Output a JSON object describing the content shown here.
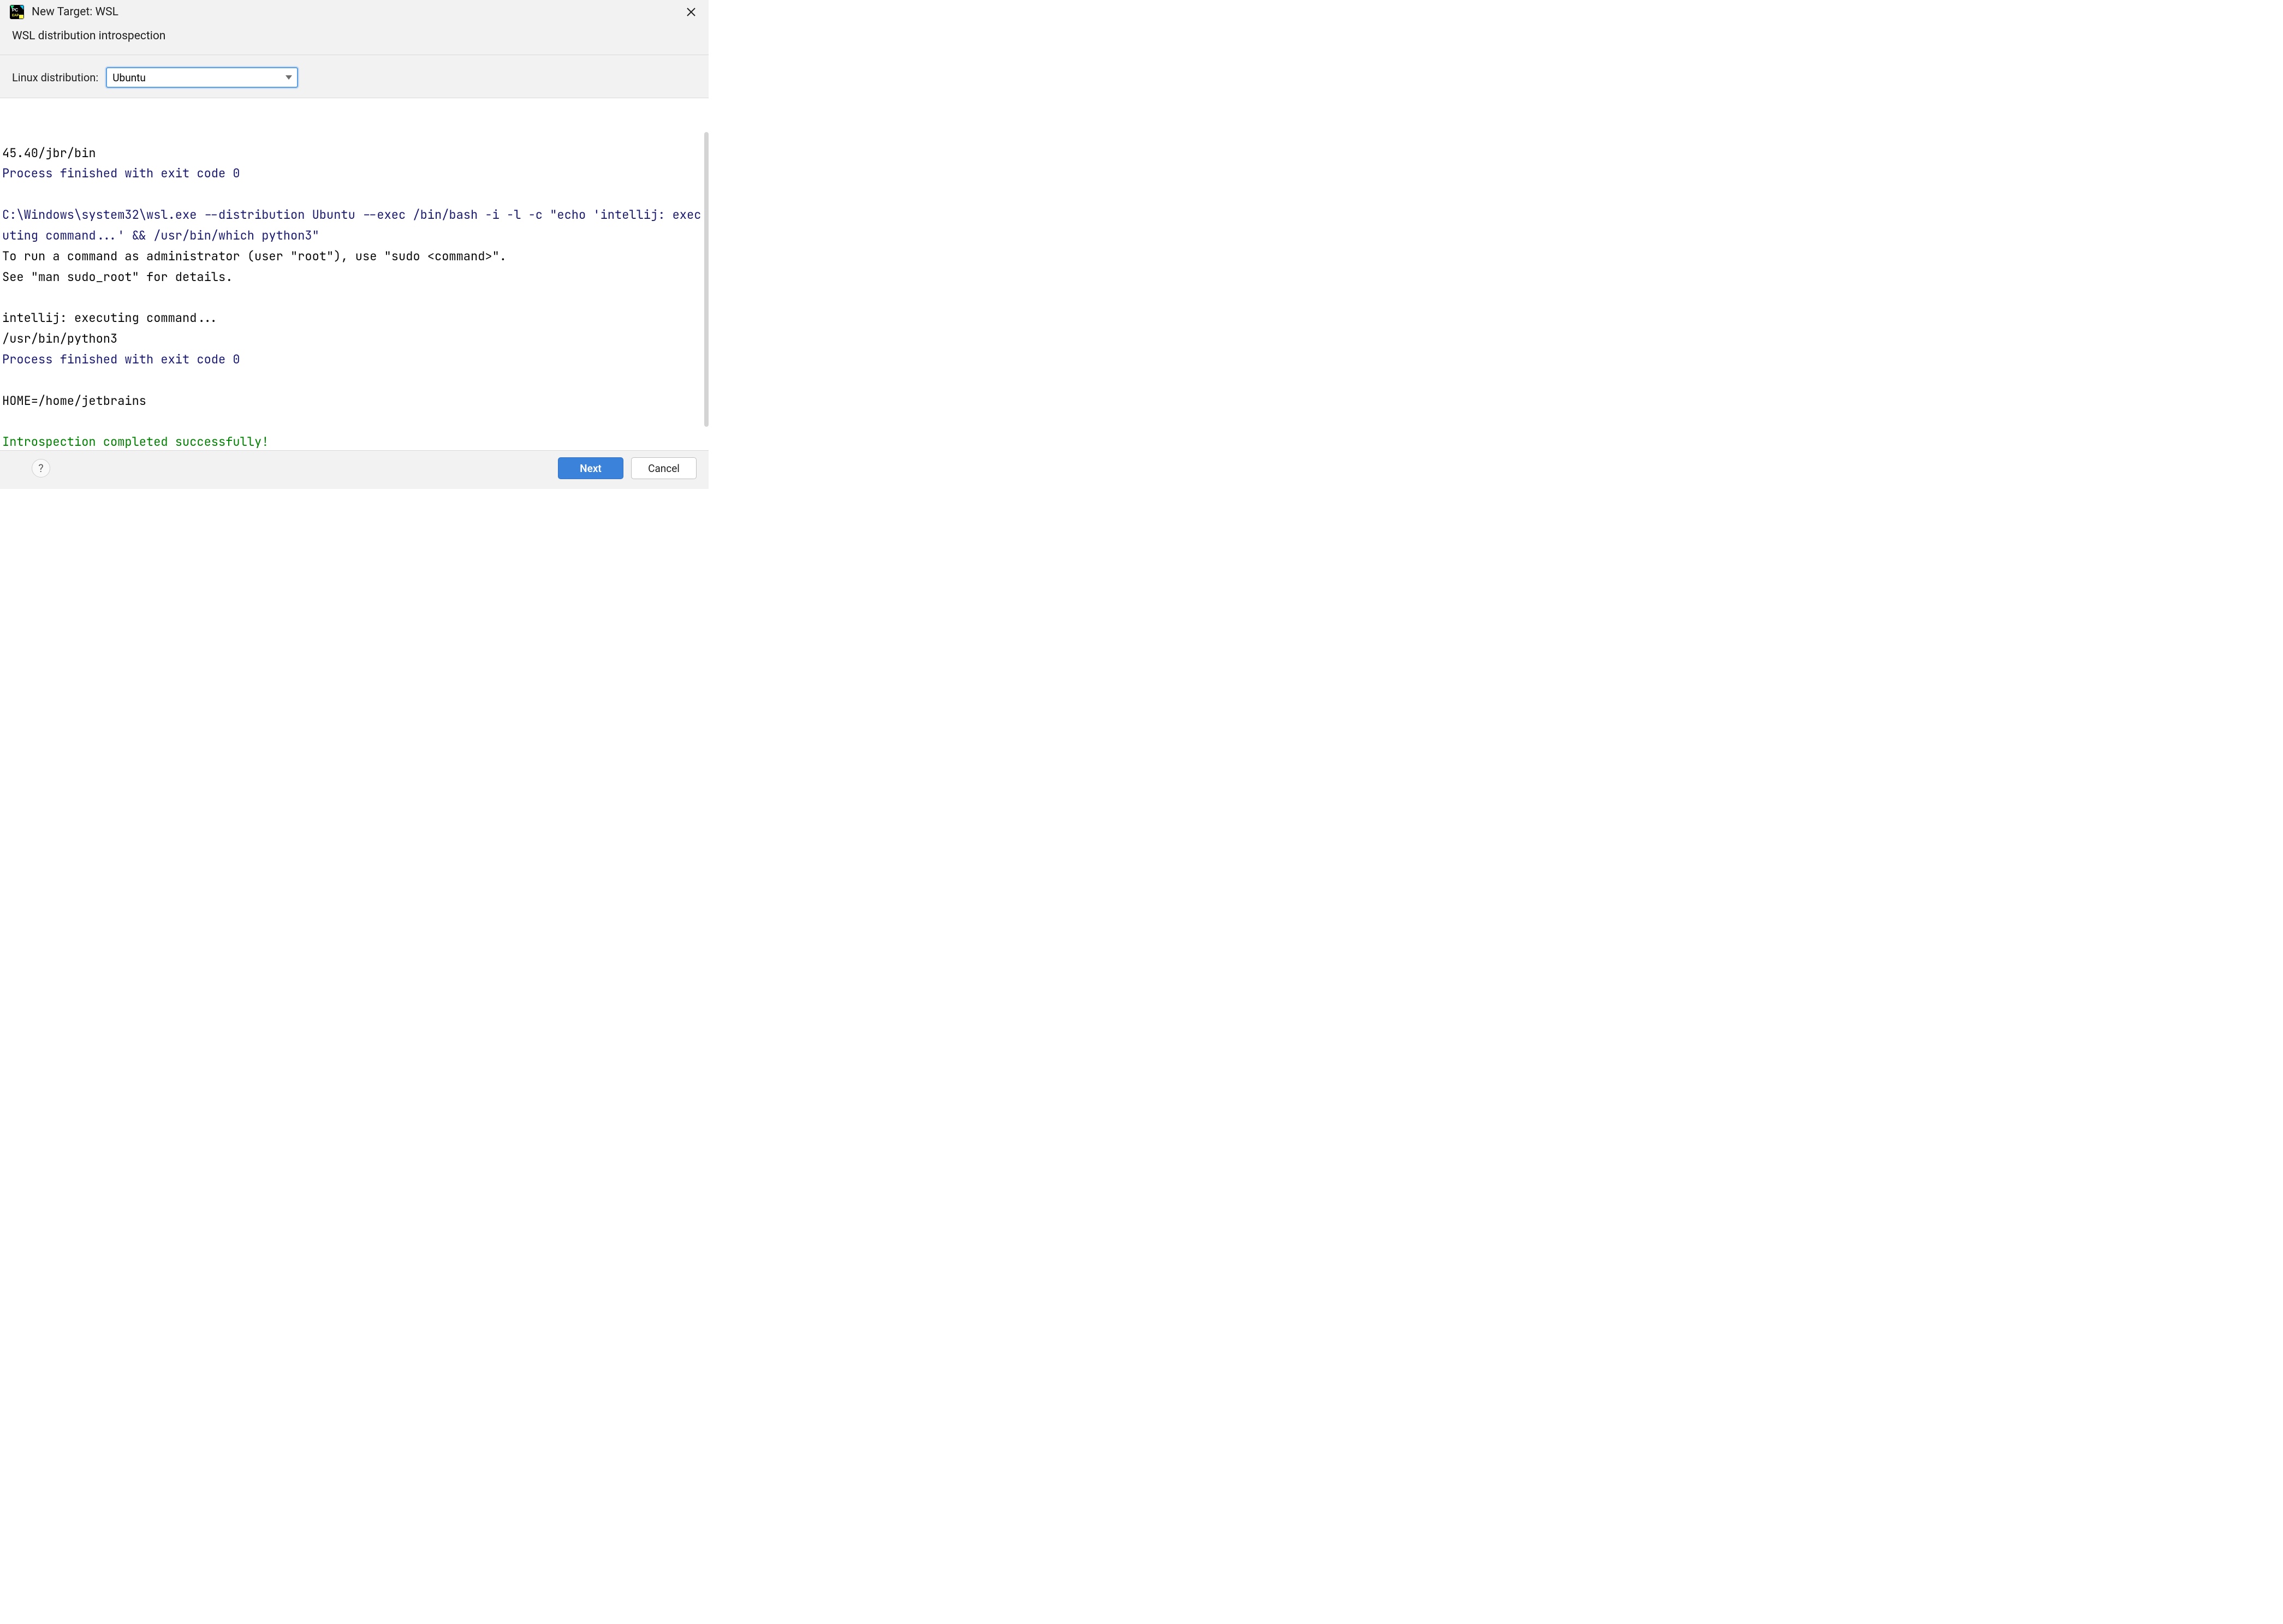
{
  "titlebar": {
    "title": "New Target: WSL"
  },
  "header": {
    "subtitle": "WSL distribution introspection"
  },
  "form": {
    "linux_label": "Linux distribution:",
    "linux_selected": "Ubuntu"
  },
  "console": {
    "lines": [
      {
        "cls": "c-black",
        "text": "45.40/jbr/bin"
      },
      {
        "cls": "c-blue",
        "text": "Process finished with exit code 0"
      },
      {
        "cls": "c-black",
        "text": ""
      },
      {
        "cls": "c-blue",
        "text": "C:\\Windows\\system32\\wsl.exe --distribution Ubuntu --exec /bin/bash -i -l -c \"echo 'intellij: executing command...' && /usr/bin/which python3\""
      },
      {
        "cls": "c-black",
        "text": "To run a command as administrator (user \"root\"), use \"sudo <command>\"."
      },
      {
        "cls": "c-black",
        "text": "See \"man sudo_root\" for details."
      },
      {
        "cls": "c-black",
        "text": ""
      },
      {
        "cls": "c-black",
        "text": "intellij: executing command..."
      },
      {
        "cls": "c-black",
        "text": "/usr/bin/python3"
      },
      {
        "cls": "c-blue",
        "text": "Process finished with exit code 0"
      },
      {
        "cls": "c-black",
        "text": ""
      },
      {
        "cls": "c-black",
        "text": "HOME=/home/jetbrains"
      },
      {
        "cls": "c-black",
        "text": ""
      },
      {
        "cls": "c-green",
        "text": "Introspection completed successfully!"
      }
    ]
  },
  "footer": {
    "help": "?",
    "next": "Next",
    "cancel": "Cancel"
  }
}
